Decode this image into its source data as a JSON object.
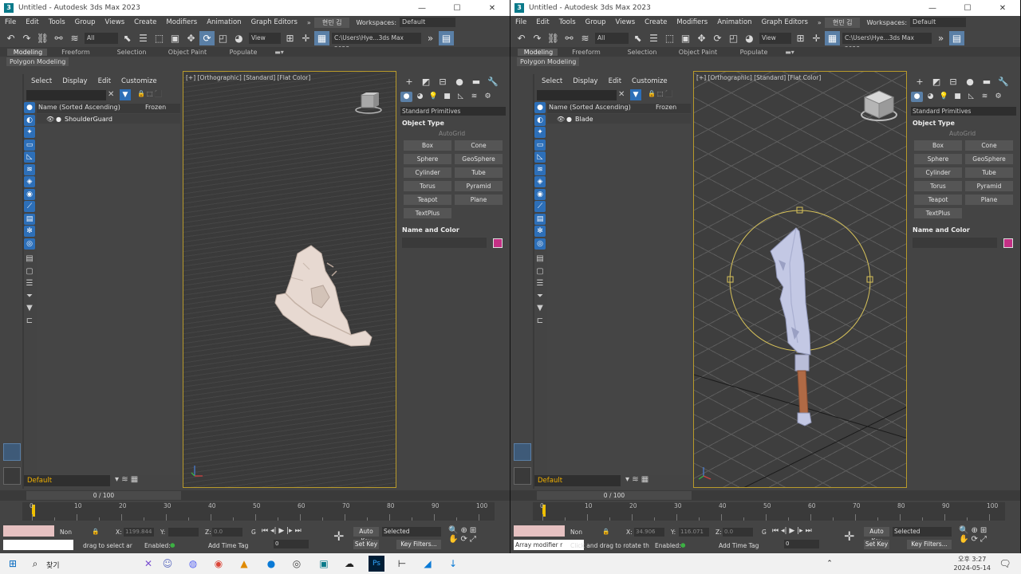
{
  "windows": [
    {
      "id": "left",
      "title": "Untitled - Autodesk 3ds Max 2023",
      "user": "현민 김",
      "workspaces_label": "Workspaces:",
      "workspace": "Default",
      "menu": [
        "File",
        "Edit",
        "Tools",
        "Group",
        "Views",
        "Create",
        "Modifiers",
        "Animation",
        "Graph Editors"
      ],
      "toolbar": {
        "selection_filter": "All",
        "ref_coord": "View",
        "path": "C:\\Users\\Hye...3ds Max 2023"
      },
      "ribbon_tabs": [
        "Modeling",
        "Freeform",
        "Selection",
        "Object Paint",
        "Populate"
      ],
      "ribbon_sub": "Polygon Modeling",
      "scene_menu": [
        "Select",
        "Display",
        "Edit",
        "Customize"
      ],
      "scene_columns": {
        "name": "Name (Sorted Ascending)",
        "frozen": "Frozen"
      },
      "scene_objects": [
        "ShoulderGuard"
      ],
      "viewport_label": "[+] [Orthographic] [Standard] [Flat Color]",
      "command": {
        "category": "Standard Primitives",
        "object_type": "Object Type",
        "autogrid": "AutoGrid",
        "primitives": [
          "Box",
          "Cone",
          "Sphere",
          "GeoSphere",
          "Cylinder",
          "Tube",
          "Torus",
          "Pyramid",
          "Teapot",
          "Plane",
          "TextPlus"
        ],
        "name_color": "Name and Color",
        "swatch_color": "#c43085"
      },
      "layer": "Default",
      "frame": "0 / 100",
      "ruler": [
        "0",
        "10",
        "20",
        "30",
        "40",
        "50",
        "60",
        "70",
        "80",
        "90",
        "100"
      ],
      "status": {
        "msg": "",
        "prompt": "drag to select ar",
        "x_label": "X:",
        "x_value": "1199.844",
        "y_label": "Y:",
        "y_value": "",
        "z_label": "Z:",
        "z_value": "0.0",
        "g_label": "G",
        "enabled": "Enabled:",
        "add_time_tag": "Add Time Tag",
        "auto_key": "Auto Key",
        "set_key": "Set Key",
        "key_mode": "Selected",
        "key_filters": "Key Filters...",
        "frame_field": "0",
        "non_label": "Non"
      }
    },
    {
      "id": "right",
      "title": "Untitled - Autodesk 3ds Max 2023",
      "user": "현민 김",
      "workspaces_label": "Workspaces:",
      "workspace": "Default",
      "menu": [
        "File",
        "Edit",
        "Tools",
        "Group",
        "Views",
        "Create",
        "Modifiers",
        "Animation",
        "Graph Editors"
      ],
      "toolbar": {
        "selection_filter": "All",
        "ref_coord": "View",
        "path": "C:\\Users\\Hye...3ds Max 2023"
      },
      "ribbon_tabs": [
        "Modeling",
        "Freeform",
        "Selection",
        "Object Paint",
        "Populate"
      ],
      "ribbon_sub": "Polygon Modeling",
      "scene_menu": [
        "Select",
        "Display",
        "Edit",
        "Customize"
      ],
      "scene_columns": {
        "name": "Name (Sorted Ascending)",
        "frozen": "Frozen"
      },
      "scene_objects": [
        "Blade"
      ],
      "viewport_label": "[+] [Orthographic] [Standard] [Flat Color]",
      "command": {
        "category": "Standard Primitives",
        "object_type": "Object Type",
        "autogrid": "AutoGrid",
        "primitives": [
          "Box",
          "Cone",
          "Sphere",
          "GeoSphere",
          "Cylinder",
          "Tube",
          "Torus",
          "Pyramid",
          "Teapot",
          "Plane",
          "TextPlus"
        ],
        "name_color": "Name and Color",
        "swatch_color": "#c43085"
      },
      "layer": "Default",
      "frame": "0 / 100",
      "ruler": [
        "0",
        "10",
        "20",
        "30",
        "40",
        "50",
        "60",
        "70",
        "80",
        "90",
        "100"
      ],
      "status": {
        "msg": "Array modifier r",
        "prompt": "Click and drag to rotate th",
        "x_label": "X:",
        "x_value": "34.906",
        "y_label": "Y:",
        "y_value": "116.071",
        "z_label": "Z:",
        "z_value": "0.0",
        "g_label": "G",
        "enabled": "Enabled:",
        "add_time_tag": "Add Time Tag",
        "auto_key": "Auto Key",
        "set_key": "Set Key",
        "key_mode": "Selected",
        "key_filters": "Key Filters...",
        "frame_field": "0",
        "non_label": "Non"
      }
    }
  ],
  "taskbar": {
    "search": "찾기",
    "time": "오후 3:27",
    "date": "2024-05-14"
  }
}
